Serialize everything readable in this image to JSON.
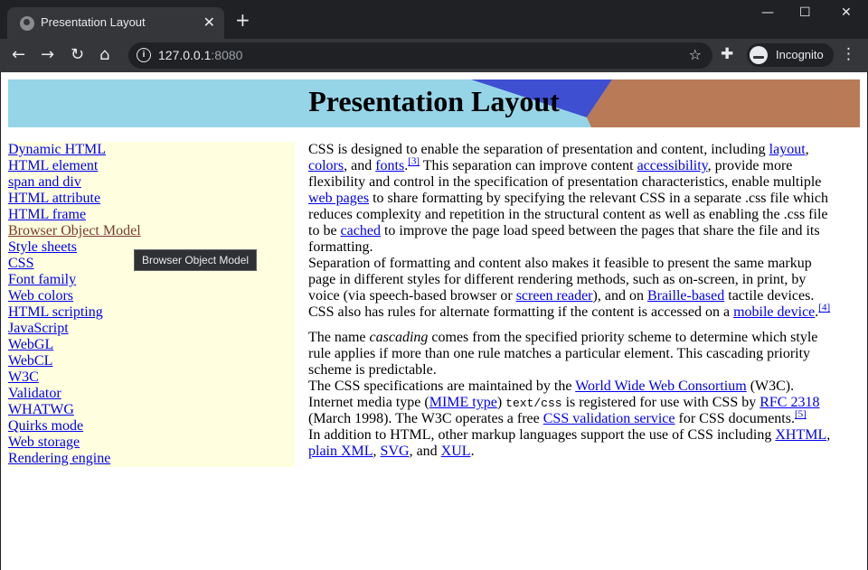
{
  "browser": {
    "tab_title": "Presentation Layout",
    "url_host": "127.0.0.1",
    "url_port": ":8080",
    "incognito_label": "Incognito"
  },
  "page": {
    "heading": "Presentation Layout",
    "nav_links": [
      "Dynamic HTML",
      "HTML element",
      "span and div",
      "HTML attribute",
      "HTML frame",
      "Browser Object Model",
      "Style sheets",
      "CSS",
      "Font family",
      "Web colors",
      "HTML scripting",
      "JavaScript",
      "WebGL",
      "WebCL",
      "W3C",
      "Validator",
      "WHATWG",
      "Quirks mode",
      "Web storage",
      "Rendering engine"
    ],
    "tooltip": "Browser Object Model",
    "p1": {
      "t1": "CSS is designed to enable the separation of presentation and content, including ",
      "l_layout": "layout",
      "t2": ", ",
      "l_colors": "colors",
      "t3": ", and ",
      "l_fonts": "fonts",
      "s3": "[3]",
      "t4": " This separation can improve content ",
      "l_access": "accessibility",
      "t5": ", provide more flexibility and control in the specification of presentation characteristics, enable multiple ",
      "l_web": "web pages",
      "t6": " to share formatting by specifying the relevant CSS in a separate .css file which reduces complexity and repetition in the structural content as well as enabling the .css file to be ",
      "l_cached": "cached",
      "t7": " to improve the page load speed between the pages that share the file and its formatting."
    },
    "p2": {
      "t1": "Separation of formatting and content also makes it feasible to present the same markup page in different styles for different rendering methods, such as on-screen, in print, by voice (via speech-based browser or ",
      "l_screen": "screen reader",
      "t2": "), and on ",
      "l_braille": "Braille-based",
      "t3": " tactile devices. CSS also has rules for alternate formatting if the content is accessed on a ",
      "l_mobile": "mobile device",
      "t4": ".",
      "s4": "[4]"
    },
    "p3": {
      "t1": "The name ",
      "em": "cascading",
      "t2": " comes from the specified priority scheme to determine which style rule applies if more than one rule matches a particular element. This cascading priority scheme is predictable."
    },
    "p4": {
      "t1": "The CSS specifications are maintained by the ",
      "l_w3c": "World Wide Web Consortium",
      "t2": " (W3C). Internet media type (",
      "l_mime": "MIME type",
      "t3": ") ",
      "code": "text/css",
      "t4": " is registered for use with CSS by ",
      "l_rfc": "RFC 2318",
      "t5": " (March 1998). The W3C operates a free ",
      "l_valid": "CSS validation service",
      "t6": " for CSS documents.",
      "s5": "[5]"
    },
    "p5": {
      "t1": "In addition to HTML, other markup languages support the use of CSS including ",
      "l_xhtml": "XHTML",
      "t2": ", ",
      "l_xml": "plain XML",
      "t3": ", ",
      "l_svg": "SVG",
      "t4": ", and ",
      "l_xul": "XUL",
      "t5": "."
    }
  }
}
